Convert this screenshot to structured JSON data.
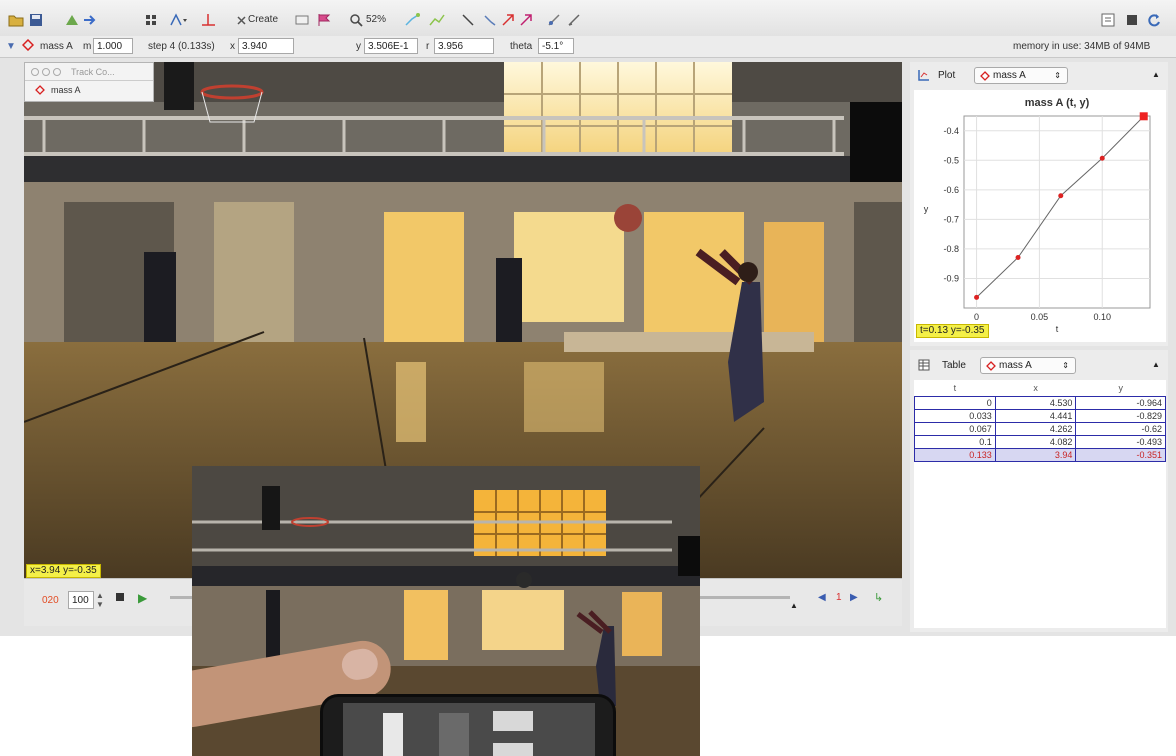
{
  "toolbar": {
    "create_label": "Create",
    "zoom_label": "52%",
    "memory_text": "memory in use: 34MB of 94MB"
  },
  "track_bar": {
    "track_name": "mass A",
    "m_label": "m",
    "m_value": "1.000",
    "step_label": "step 4 (0.133s)",
    "x_label": "x",
    "x_value": "3.940",
    "y_label": "y",
    "y_value": "3.506E-1",
    "r_label": "r",
    "r_value": "3.956",
    "theta_label": "theta",
    "theta_value": "-5.1°"
  },
  "track_control": {
    "title": "Track Co...",
    "item": "mass A"
  },
  "video": {
    "readout": "x=3.94  y=-0.35",
    "frame_value": "020",
    "rate_value": "100"
  },
  "plot_panel": {
    "label": "Plot",
    "selector": "mass A",
    "readout": "t=0.13  y=-0.35"
  },
  "table_panel": {
    "label": "Table",
    "selector": "mass A",
    "columns": [
      "t",
      "x",
      "y"
    ],
    "rows": [
      [
        "0",
        "4.530",
        "-0.964"
      ],
      [
        "0.033",
        "4.441",
        "-0.829"
      ],
      [
        "0.067",
        "4.262",
        "-0.62"
      ],
      [
        "0.1",
        "4.082",
        "-0.493"
      ],
      [
        "0.133",
        "3.94",
        "-0.351"
      ]
    ]
  },
  "chart_data": {
    "type": "line",
    "title": "mass A (t, y)",
    "xlabel": "t",
    "ylabel": "y",
    "x": [
      0,
      0.033,
      0.067,
      0.1,
      0.133
    ],
    "y": [
      -0.964,
      -0.829,
      -0.62,
      -0.493,
      -0.351
    ],
    "xlim": [
      -0.01,
      0.138
    ],
    "ylim": [
      -1.0,
      -0.35
    ],
    "xticks": [
      0,
      0.05,
      0.1
    ],
    "xtick_labels": [
      "0",
      "0.05",
      "0.10"
    ],
    "yticks": [
      -0.9,
      -0.8,
      -0.7,
      -0.6,
      -0.5,
      -0.4
    ],
    "ytick_labels": [
      "-0.9",
      "-0.8",
      "-0.7",
      "-0.6",
      "-0.5",
      "-0.4"
    ],
    "grid": true,
    "colors": {
      "line": "#666666",
      "point": "#dd2222",
      "selected": "#ee2222"
    }
  }
}
